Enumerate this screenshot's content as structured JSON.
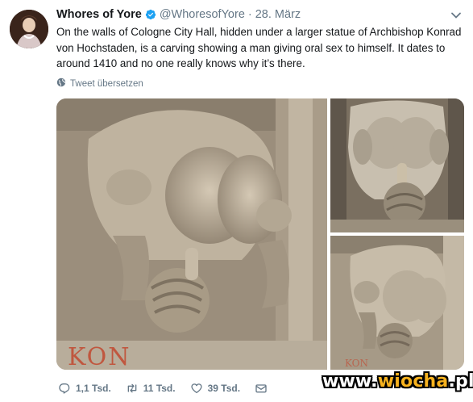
{
  "author": {
    "name": "Whores of Yore",
    "handle": "@WhoresofYore",
    "separator": "·",
    "date": "28. März"
  },
  "tweet": {
    "text": "On the walls of Cologne City Hall, hidden under a larger statue of Archbishop Konrad von Hochstaden,  is a carving showing a man giving oral sex to himself. It dates to around 1410 and no one really knows why it’s there.",
    "translate_label": "Tweet übersetzen"
  },
  "media": {
    "carved_letters": "KON",
    "panels": [
      "main-photo",
      "top-right-photo",
      "bottom-right-photo"
    ]
  },
  "actions": {
    "reply_count": "1,1 Tsd.",
    "retweet_count": "11 Tsd.",
    "like_count": "39 Tsd."
  },
  "watermark": {
    "prefix": "www.",
    "brand": "wiocha",
    "suffix": ".pl"
  },
  "colors": {
    "text": "#14171a",
    "secondary": "#657786",
    "verified": "#1da1f2",
    "stone": "#b8ac9a"
  },
  "icons": [
    "verified-badge-icon",
    "chevron-down-icon",
    "globe-icon",
    "reply-icon",
    "retweet-icon",
    "like-icon",
    "mail-icon"
  ]
}
